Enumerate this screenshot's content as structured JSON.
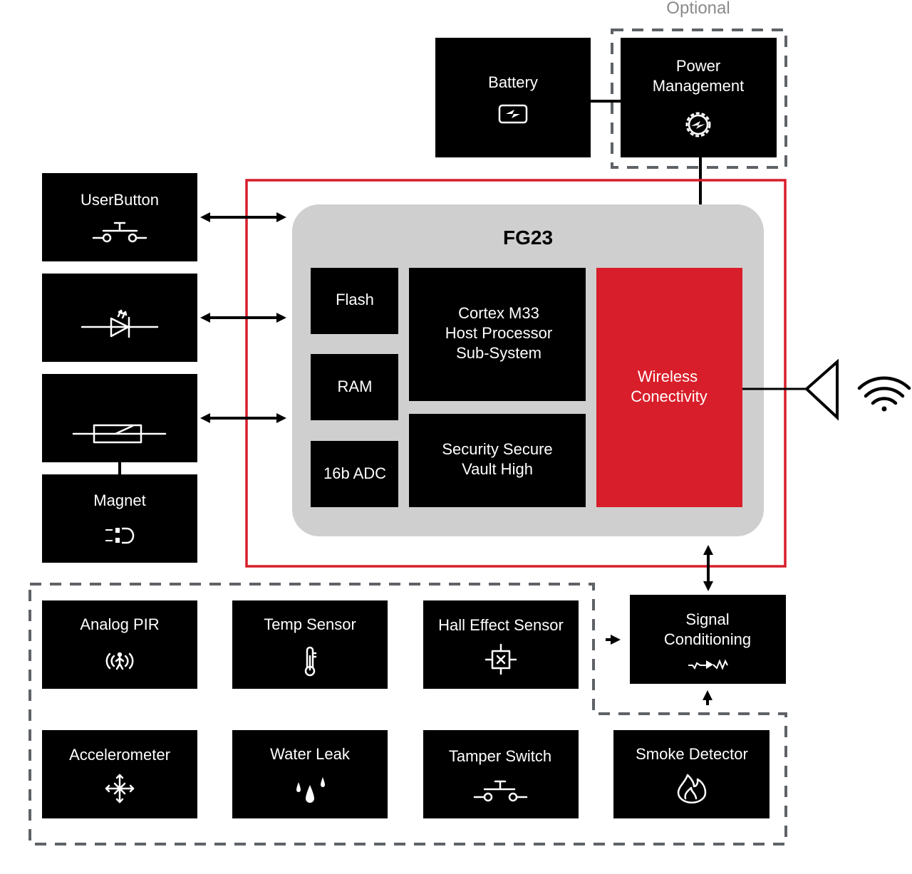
{
  "colors": {
    "accent_red": "#d81e2a",
    "block_black": "#000000",
    "chip_gray": "#d0cfcf",
    "dashed_gray": "#5f6266",
    "optional_text": "#8a8a8a"
  },
  "optional_label": "Optional",
  "power": {
    "battery": {
      "label": "Battery",
      "icon": "battery-charging-icon"
    },
    "power_management": {
      "lines": [
        "Power",
        "Management"
      ],
      "icon": "gear-bolt-icon"
    }
  },
  "chip": {
    "title": "FG23",
    "flash": "Flash",
    "ram": "RAM",
    "adc": "16b ADC",
    "cortex": [
      "Cortex M33",
      "Host Processor",
      "Sub-System"
    ],
    "security": [
      "Security Secure",
      "Vault High"
    ],
    "wireless": [
      "Wireless",
      "Conectivity"
    ]
  },
  "left_blocks": [
    {
      "label": "UserButton",
      "icon": "push-button-icon"
    },
    {
      "label": "",
      "icon": "led-icon"
    },
    {
      "label": "",
      "icon": "reed-switch-icon"
    },
    {
      "label": "Magnet",
      "icon": "magnet-icon"
    }
  ],
  "signal_conditioning": {
    "lines": [
      "Signal",
      "Conditioning"
    ],
    "icon": "signal-waveform-icon"
  },
  "sensors": [
    {
      "label": "Analog PIR",
      "icon": "motion-person-icon"
    },
    {
      "label": "Temp Sensor",
      "icon": "thermometer-icon"
    },
    {
      "label": "Hall Effect Sensor",
      "icon": "hall-sensor-icon"
    },
    {
      "label": "Accelerometer",
      "icon": "move-arrows-icon"
    },
    {
      "label": "Water Leak",
      "icon": "water-drops-icon"
    },
    {
      "label": "Tamper Switch",
      "icon": "push-button-icon"
    },
    {
      "label": "Smoke Detector",
      "icon": "flame-icon"
    }
  ],
  "antenna": {
    "icon": "antenna-icon",
    "wifi_icon": "wifi-icon"
  }
}
